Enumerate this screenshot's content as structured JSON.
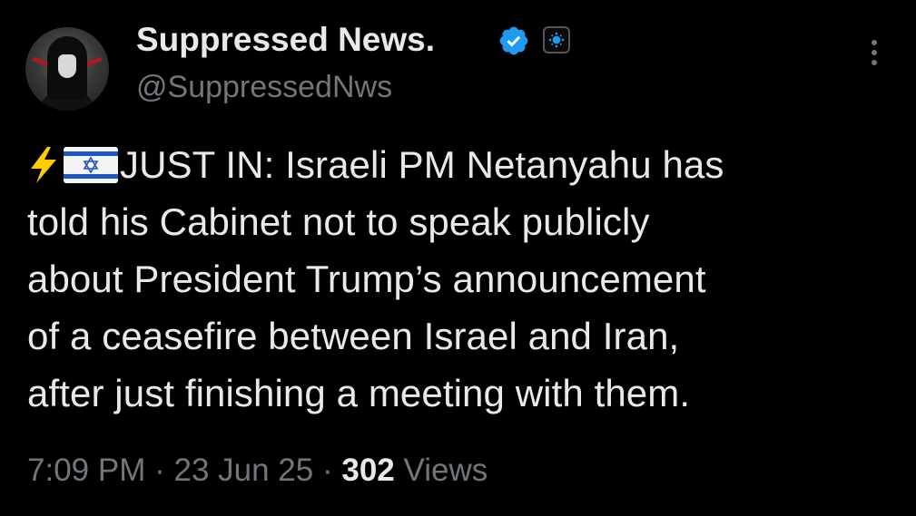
{
  "user": {
    "display_name": "Suppressed News.",
    "handle": "@SuppressedNws",
    "verified": true,
    "verified_color": "#1d9bf0",
    "avatar_icon": "hooded-figure-avatar",
    "affiliation_badge_icon": "affiliation-badge-icon"
  },
  "tweet": {
    "prefix_icons": [
      "high-voltage-emoji",
      "israel-flag-emoji"
    ],
    "lines": [
      "JUST IN: Israeli PM Netanyahu has",
      "told his Cabinet not to speak publicly",
      "about President Trump’s announcement",
      "of a ceasefire between Israel and Iran,",
      "after just finishing a meeting with them."
    ]
  },
  "meta": {
    "time": "7:09 PM",
    "date": "23 Jun 25",
    "separator": "·",
    "views_count": "302",
    "views_label": "Views"
  },
  "colors": {
    "background": "#000000",
    "text": "#e7e9ea",
    "secondary": "#71767b",
    "accent": "#1d9bf0"
  }
}
